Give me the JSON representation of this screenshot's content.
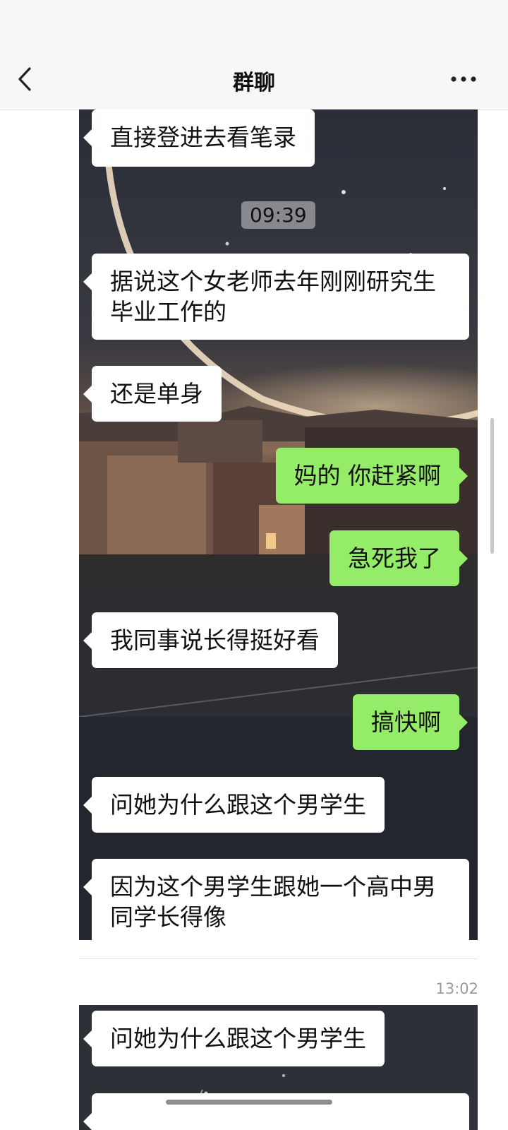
{
  "header": {
    "title": "群聊",
    "back_icon": "chevron-left-icon",
    "more_icon": "more-dots-icon"
  },
  "screenshot1": {
    "messages": [
      {
        "side": "left",
        "text": "直接登进去看笔录"
      },
      {
        "side": "time",
        "text": "09:39"
      },
      {
        "side": "left",
        "text": "据说这个女老师去年刚刚研究生毕业工作的"
      },
      {
        "side": "left",
        "text": "还是单身"
      },
      {
        "side": "right",
        "text": "妈的 你赶紧啊"
      },
      {
        "side": "right",
        "text": "急死我了"
      },
      {
        "side": "left",
        "text": "我同事说长得挺好看"
      },
      {
        "side": "right",
        "text": "搞快啊"
      },
      {
        "side": "left",
        "text": "问她为什么跟这个男学生"
      },
      {
        "side": "left",
        "text": "因为这个男学生跟她一个高中男同学长得像"
      }
    ]
  },
  "message_time": "13:02",
  "screenshot2": {
    "messages": [
      {
        "side": "left",
        "text": "问她为什么跟这个男学生"
      }
    ]
  },
  "colors": {
    "incoming_bubble": "#ffffff",
    "outgoing_bubble": "#95ec69",
    "header_bg": "#f7f7f7"
  }
}
